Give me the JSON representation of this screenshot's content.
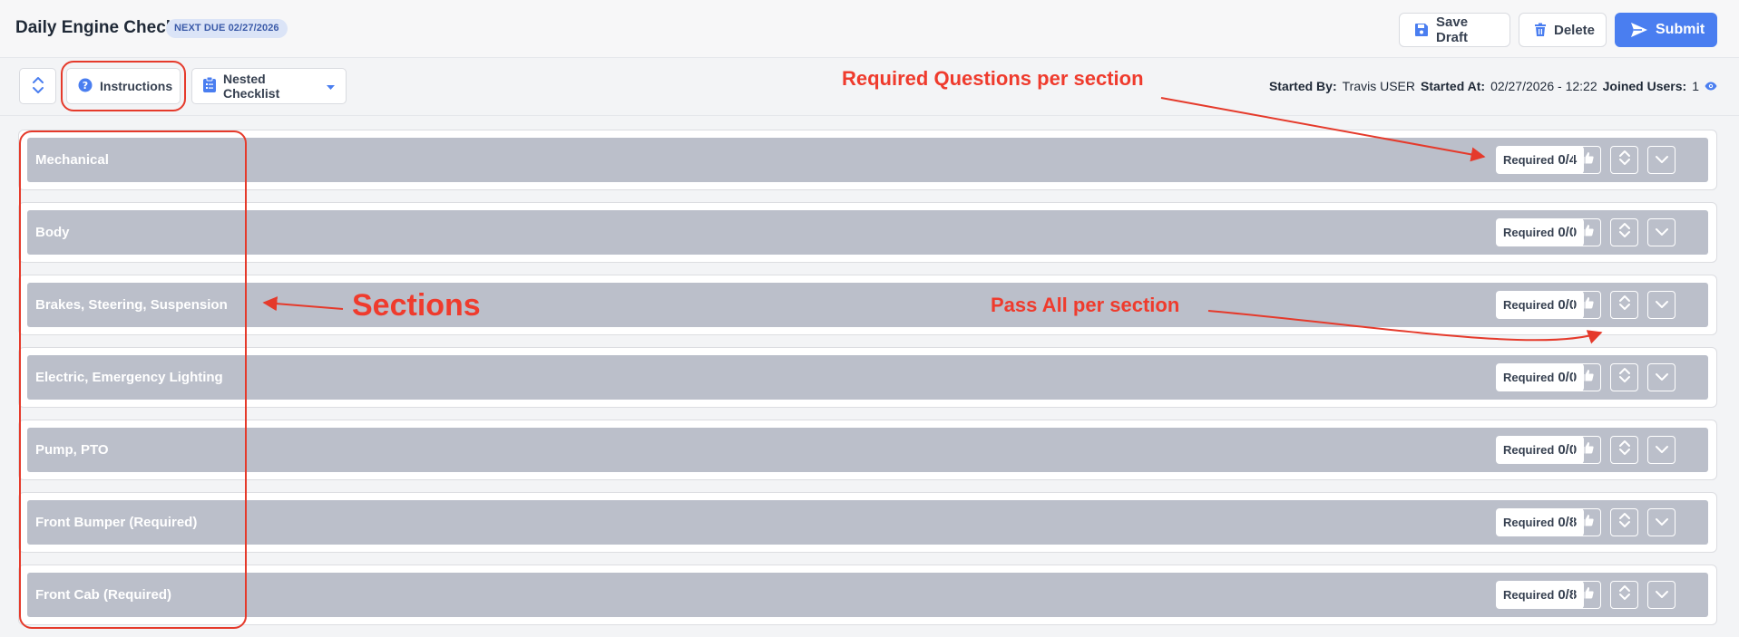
{
  "header": {
    "title": "Daily Engine Check",
    "due_badge": "NEXT DUE 02/27/2026",
    "save_draft": "Save Draft",
    "delete": "Delete",
    "submit": "Submit"
  },
  "toolbar": {
    "instructions": "Instructions",
    "nested_checklist": "Nested Checklist"
  },
  "meta": {
    "started_by_label": "Started By:",
    "started_by_value": "Travis USER",
    "started_at_label": "Started At:",
    "started_at_value": "02/27/2026 - 12:22",
    "joined_label": "Joined Users:",
    "joined_value": "1"
  },
  "required_label": "Required",
  "sections": [
    {
      "name": "Mechanical",
      "required": "0/4"
    },
    {
      "name": "Body",
      "required": "0/0"
    },
    {
      "name": "Brakes, Steering, Suspension",
      "required": "0/0"
    },
    {
      "name": "Electric, Emergency Lighting",
      "required": "0/0"
    },
    {
      "name": "Pump, PTO",
      "required": "0/0"
    },
    {
      "name": "Front Bumper (Required)",
      "required": "0/8"
    },
    {
      "name": "Front Cab (Required)",
      "required": "0/8"
    }
  ],
  "annotations": {
    "required_per_section": "Required Questions per section",
    "sections": "Sections",
    "pass_all": "Pass All per section"
  },
  "colors": {
    "accent": "#4a7ef0",
    "section_bar": "#bbbfca",
    "annotation": "#e53a2b"
  },
  "icons": {
    "save": "floppy-disk-icon",
    "delete": "trash-icon",
    "submit": "paper-plane-icon",
    "expand": "expand-collapse-icon",
    "instructions": "question-circle-icon",
    "nested": "clipboard-list-icon",
    "joined": "eye-icon",
    "pass": "thumbs-up-icon",
    "sort": "sort-icon",
    "chevron": "chevron-down-icon"
  }
}
